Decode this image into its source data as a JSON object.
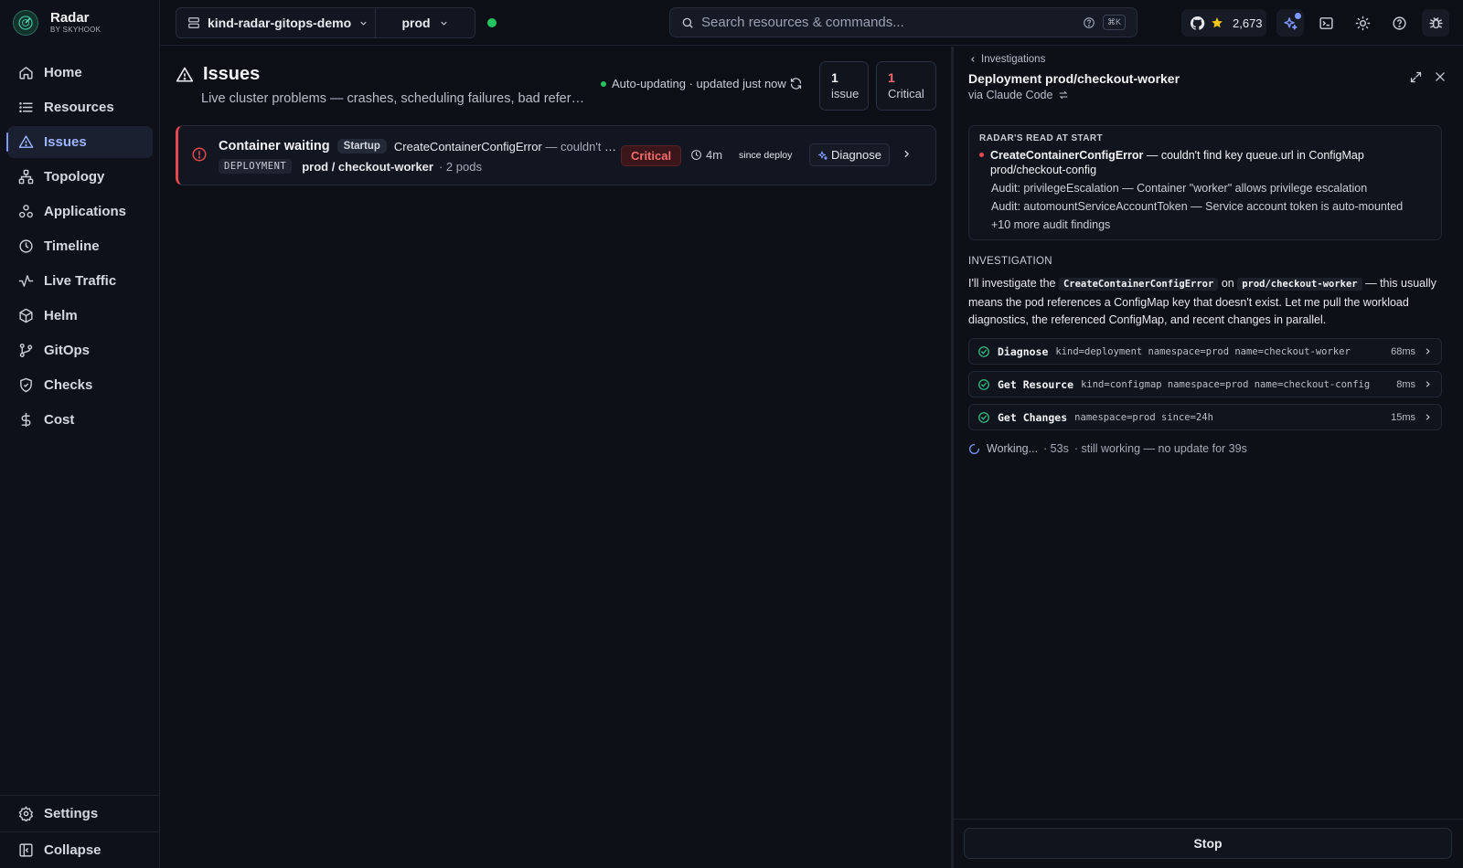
{
  "brand": {
    "name": "Radar",
    "sub": "BY SKYHOOK"
  },
  "sidebar": {
    "items": [
      {
        "label": "Home",
        "icon": "home-icon"
      },
      {
        "label": "Resources",
        "icon": "list-icon"
      },
      {
        "label": "Issues",
        "icon": "warning-icon",
        "active": true
      },
      {
        "label": "Topology",
        "icon": "topology-icon"
      },
      {
        "label": "Applications",
        "icon": "applications-icon"
      },
      {
        "label": "Timeline",
        "icon": "clock-icon"
      },
      {
        "label": "Live Traffic",
        "icon": "activity-icon"
      },
      {
        "label": "Helm",
        "icon": "package-icon"
      },
      {
        "label": "GitOps",
        "icon": "git-branch-icon"
      },
      {
        "label": "Checks",
        "icon": "shield-check-icon"
      },
      {
        "label": "Cost",
        "icon": "dollar-icon"
      }
    ],
    "settings_label": "Settings",
    "collapse_label": "Collapse"
  },
  "topbar": {
    "cluster": "kind-radar-gitops-demo",
    "namespace": "prod",
    "connection_status_color": "#22c55e",
    "search_placeholder": "Search resources & commands...",
    "search_shortcut": "⌘K",
    "github_stars": "2,673"
  },
  "issues_page": {
    "title": "Issues",
    "subtitle": "Live cluster problems — crashes, scheduling failures, bad refere...",
    "auto_update": "Auto-updating · updated just now",
    "stats": [
      {
        "value": "1",
        "label": "issue"
      },
      {
        "value": "1",
        "label": "Critical"
      }
    ],
    "issue": {
      "title": "Container waiting",
      "phase": "Startup",
      "reason": "CreateContainerConfigError",
      "reason_detail": " — couldn't fin...",
      "kind": "DEPLOYMENT",
      "resource": "prod / checkout-worker",
      "pods": "· 2 pods",
      "severity": "Critical",
      "age": "4m",
      "since": "since deploy",
      "action": "Diagnose"
    }
  },
  "panel": {
    "back_label": "Investigations",
    "title": "Deployment prod/checkout-worker",
    "via": "via Claude Code",
    "read": {
      "heading": "RADAR'S READ AT START",
      "primary_reason": "CreateContainerConfigError",
      "primary_detail": " — couldn't find key queue.url in ConfigMap prod/checkout-config",
      "audits": [
        "Audit: privilegeEscalation — Container \"worker\" allows privilege escalation",
        "Audit: automountServiceAccountToken — Service account token is auto-mounted",
        "+10 more audit findings"
      ]
    },
    "investigation": {
      "heading": "INVESTIGATION",
      "text_1": "I'll investigate the ",
      "code_1": "CreateContainerConfigError",
      "text_2": " on ",
      "code_2": "prod/checkout-worker",
      "text_3": " — this usually means the pod references a ConfigMap key that doesn't exist. Let me pull the workload diagnostics, the referenced ConfigMap, and recent changes in parallel."
    },
    "tools": [
      {
        "name": "Diagnose",
        "args": "kind=deployment namespace=prod name=checkout-worker",
        "duration": "68ms"
      },
      {
        "name": "Get Resource",
        "args": "kind=configmap namespace=prod name=checkout-config",
        "duration": "8ms"
      },
      {
        "name": "Get Changes",
        "args": "namespace=prod since=24h",
        "duration": "15ms"
      }
    ],
    "working": {
      "label": "Working...",
      "elapsed": "· 53s",
      "note": "· still working — no update for 39s"
    },
    "stop_label": "Stop"
  }
}
